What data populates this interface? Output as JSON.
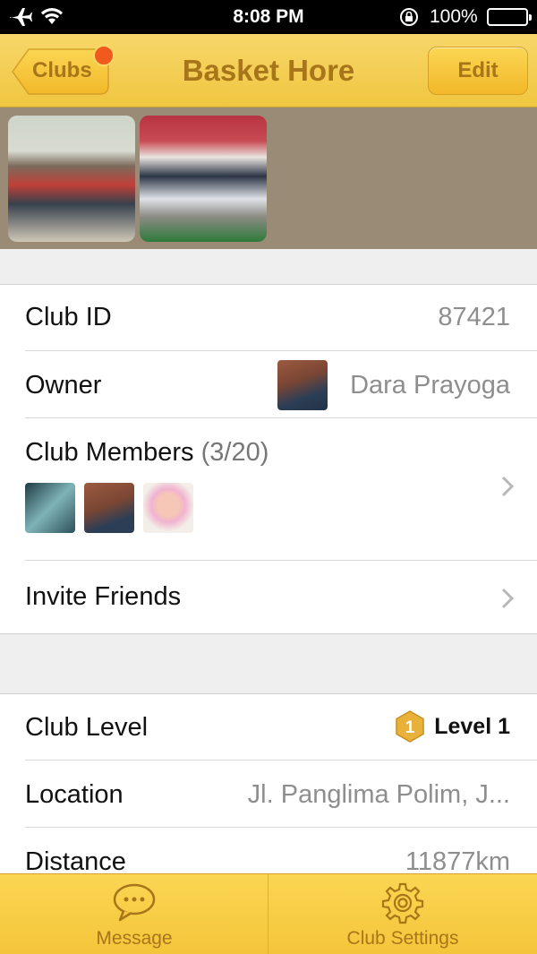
{
  "status_bar": {
    "time": "8:08 PM",
    "battery": "100%"
  },
  "nav": {
    "back_label": "Clubs",
    "title": "Basket Hore",
    "edit_label": "Edit"
  },
  "details": {
    "club_id_label": "Club ID",
    "club_id_value": "87421",
    "owner_label": "Owner",
    "owner_value": "Dara Prayoga",
    "members_label": "Club Members",
    "members_count": "(3/20)",
    "invite_label": "Invite Friends"
  },
  "info": {
    "level_label": "Club Level",
    "level_badge_number": "1",
    "level_value": "Level 1",
    "location_label": "Location",
    "location_value": "Jl. Panglima Polim, J...",
    "distance_label": "Distance",
    "distance_value": "11877km"
  },
  "tabs": [
    {
      "label": "Message",
      "icon": "chat-bubble-icon"
    },
    {
      "label": "Club Settings",
      "icon": "gear-icon"
    }
  ],
  "colors": {
    "accent": "#f4c53a",
    "accent_text": "#a8761a",
    "badge": "#f05a1c"
  }
}
